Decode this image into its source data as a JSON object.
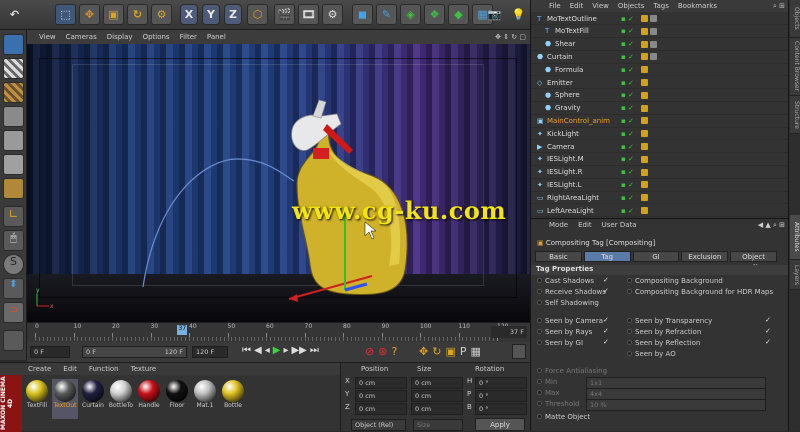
{
  "toolbar": {
    "axes": [
      "X",
      "Y",
      "Z"
    ]
  },
  "viewport": {
    "menu": [
      "View",
      "Cameras",
      "Display",
      "Options",
      "Filter",
      "Panel"
    ],
    "watermark": "www.cg-ku.com"
  },
  "timeline": {
    "ticks": [
      "0",
      "10",
      "20",
      "30",
      "40",
      "50",
      "60",
      "70",
      "80",
      "90",
      "100",
      "110",
      "120"
    ],
    "current_frame": "37 F",
    "playhead_value": "37",
    "playhead_fraction": 0.308
  },
  "controls": {
    "start": "0 F",
    "range_start": "0 F",
    "range_end": "120 F",
    "end": "120 F"
  },
  "materials": {
    "menu": [
      "Create",
      "Edit",
      "Function",
      "Texture"
    ],
    "items": [
      {
        "name": "TextFill",
        "color": "#d8c21c"
      },
      {
        "name": "TextOut",
        "color": "#5a5a5a",
        "selected": true
      },
      {
        "name": "Curtain",
        "color": "#202040"
      },
      {
        "name": "BottleTo",
        "color": "#d0d0d0"
      },
      {
        "name": "Handle",
        "color": "#c8101a"
      },
      {
        "name": "Floor",
        "color": "#111111"
      },
      {
        "name": "Mat.1",
        "color": "#bfbfbf"
      },
      {
        "name": "Bottle",
        "color": "#e0c020"
      }
    ]
  },
  "coords": {
    "headers": [
      "Position",
      "Size",
      "Rotation"
    ],
    "rows": [
      {
        "axis": "X",
        "pos": "0 cm",
        "size": "0 cm",
        "rot_label": "H",
        "rot": "0 °"
      },
      {
        "axis": "Y",
        "pos": "0 cm",
        "size": "0 cm",
        "rot_label": "P",
        "rot": "0 °"
      },
      {
        "axis": "Z",
        "pos": "0 cm",
        "size": "0 cm",
        "rot_label": "B",
        "rot": "0 °"
      }
    ],
    "mode": "Object (Rel)",
    "size_mode": "Size",
    "apply": "Apply"
  },
  "objects": {
    "menu": [
      "File",
      "Edit",
      "View",
      "Objects",
      "Tags",
      "Bookmarks"
    ],
    "items": [
      {
        "name": "MoTextOutline",
        "indent": 0,
        "icon": "T"
      },
      {
        "name": "MoTextFill",
        "indent": 1,
        "icon": "T"
      },
      {
        "name": "Shear",
        "indent": 1,
        "icon": "⬣"
      },
      {
        "name": "Curtain",
        "indent": 0,
        "icon": "⬣"
      },
      {
        "name": "Formula",
        "indent": 1,
        "icon": "⬣"
      },
      {
        "name": "Emitter",
        "indent": 0,
        "icon": "◇"
      },
      {
        "name": "Sphere",
        "indent": 1,
        "icon": "●"
      },
      {
        "name": "Gravity",
        "indent": 1,
        "icon": "⬣"
      },
      {
        "name": "MainControl_anim",
        "indent": 0,
        "icon": "▣",
        "highlight": true
      },
      {
        "name": "KickLight",
        "indent": 0,
        "icon": "✦"
      },
      {
        "name": "Camera",
        "indent": 0,
        "icon": "▶"
      },
      {
        "name": "IESLight.M",
        "indent": 0,
        "icon": "✦"
      },
      {
        "name": "IESLight.R",
        "indent": 0,
        "icon": "✦"
      },
      {
        "name": "IESLight.L",
        "indent": 0,
        "icon": "✦"
      },
      {
        "name": "RightAreaLight",
        "indent": 0,
        "icon": "▭"
      },
      {
        "name": "LeftAreaLight",
        "indent": 0,
        "icon": "▭"
      }
    ]
  },
  "attributes": {
    "menu": [
      "Mode",
      "Edit",
      "User Data"
    ],
    "title": "Compositing Tag [Compositing]",
    "tabs": [
      "Basic",
      "Tag",
      "GI",
      "Exclusion",
      "Object Buffer"
    ],
    "active_tab": "Tag",
    "section": "Tag Properties",
    "left1": [
      "Cast Shadows",
      "Receive Shadows",
      "Self Shadowing"
    ],
    "right1": [
      "Compositing Background",
      "Compositing Background for HDR Maps"
    ],
    "left2": [
      "Seen by Camera",
      "Seen by Rays",
      "Seen by GI"
    ],
    "right2": [
      "Seen by Transparency",
      "Seen by Refraction",
      "Seen by Reflection",
      "Seen by AO"
    ],
    "dim": [
      {
        "label": "Force Antialiasing"
      },
      {
        "label": "Min",
        "val": "1x1"
      },
      {
        "label": "Max",
        "val": "4x4"
      },
      {
        "label": "Threshold",
        "val": "10 %"
      }
    ],
    "matte": "Matte Object"
  },
  "right_tabs": [
    "Objects",
    "Content Browser",
    "Structure",
    "Attributes",
    "Layers"
  ],
  "brand": "MAXON CINEMA 4D"
}
